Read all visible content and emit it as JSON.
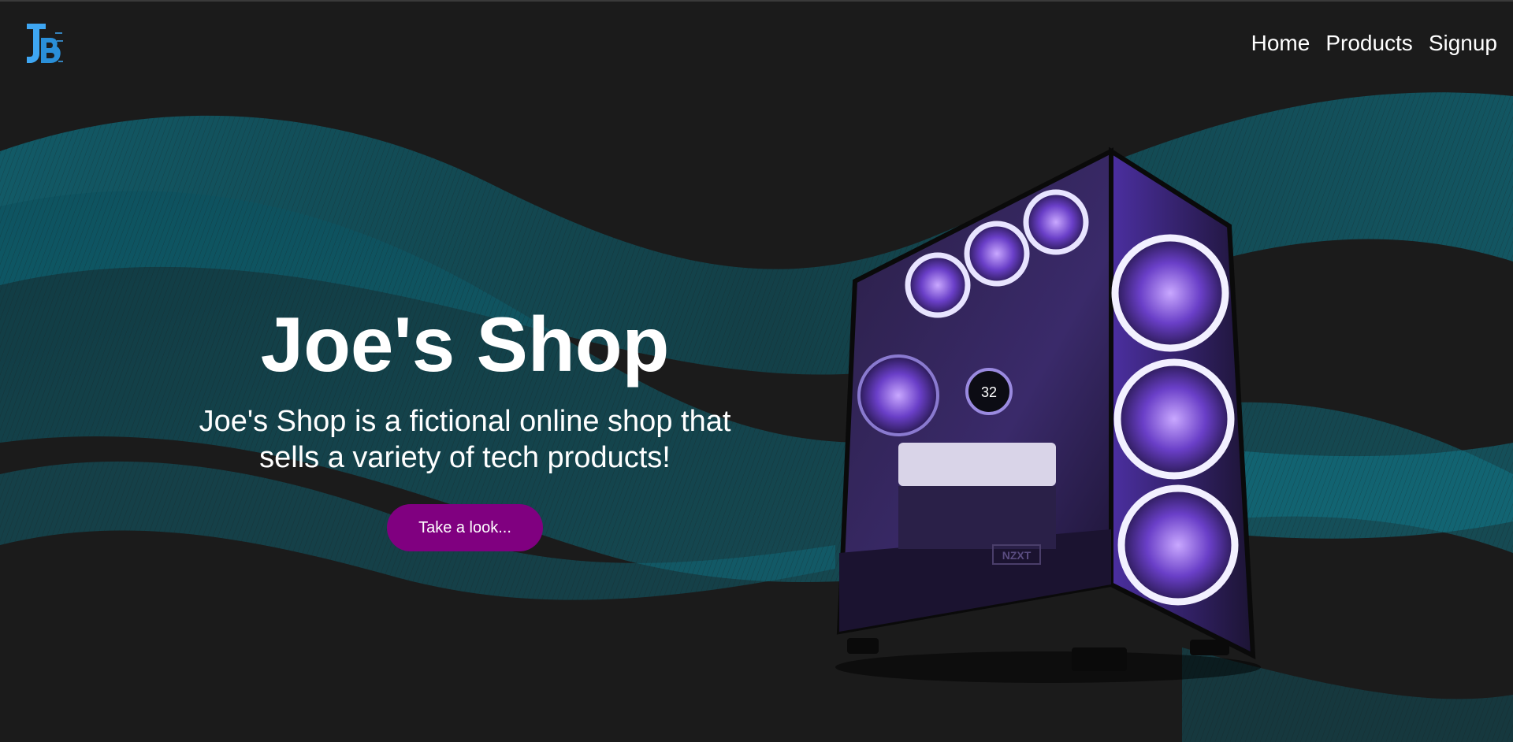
{
  "nav": {
    "links": [
      "Home",
      "Products",
      "Signup"
    ]
  },
  "hero": {
    "title": "Joe's Shop",
    "subtitle": "Joe's Shop is a fictional online shop that sells a variety of tech products!",
    "button_label": "Take a look..."
  },
  "product_image": {
    "cooler_temp": "32",
    "brand": "NZXT"
  },
  "colors": {
    "background": "#1b1b1b",
    "wave_teal": "#0f6f80",
    "button_purple": "#800080",
    "logo_blue": "#3ea6f2",
    "case_purple": "#6a3fc8"
  },
  "icons": {
    "logo": "jb-logo-icon"
  }
}
